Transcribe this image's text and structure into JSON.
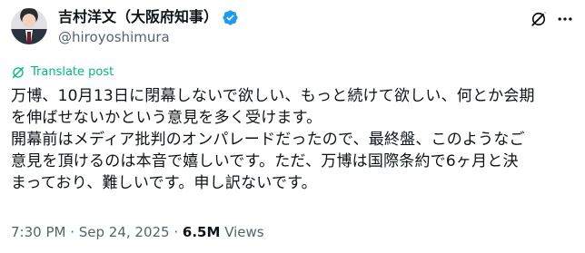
{
  "author": {
    "display_name": "吉村洋文（大阪府知事）",
    "handle": "@hiroyoshimura",
    "verified_icon": "verified-badge-icon"
  },
  "actions": {
    "grok_icon": "grok-slash-icon",
    "more_icon": "more-dots-icon"
  },
  "translate": {
    "icon": "translate-icon",
    "label": "Translate post"
  },
  "tweet": {
    "text": "万博、10月13日に閉幕しないで欲しい、もっと続けて欲しい、何とか会期\nを伸ばせないかという意見を多く受けます。\n開幕前はメディア批判のオンパレードだったので、最終盤、このようなご\n意見を頂けるのは本音で嬉しいです。ただ、万博は国際条約で6ヶ月と決\nまっており、難しいです。申し訳ないです。"
  },
  "meta": {
    "time": "7:30 PM",
    "separator": " · ",
    "date": "Sep 24, 2025",
    "views_count": "6.5M",
    "views_label": " Views"
  },
  "colors": {
    "verified_blue": "#1d9bf0",
    "translate_green": "#00ba7c",
    "secondary_text": "#536471",
    "primary_text": "#0f1419"
  }
}
